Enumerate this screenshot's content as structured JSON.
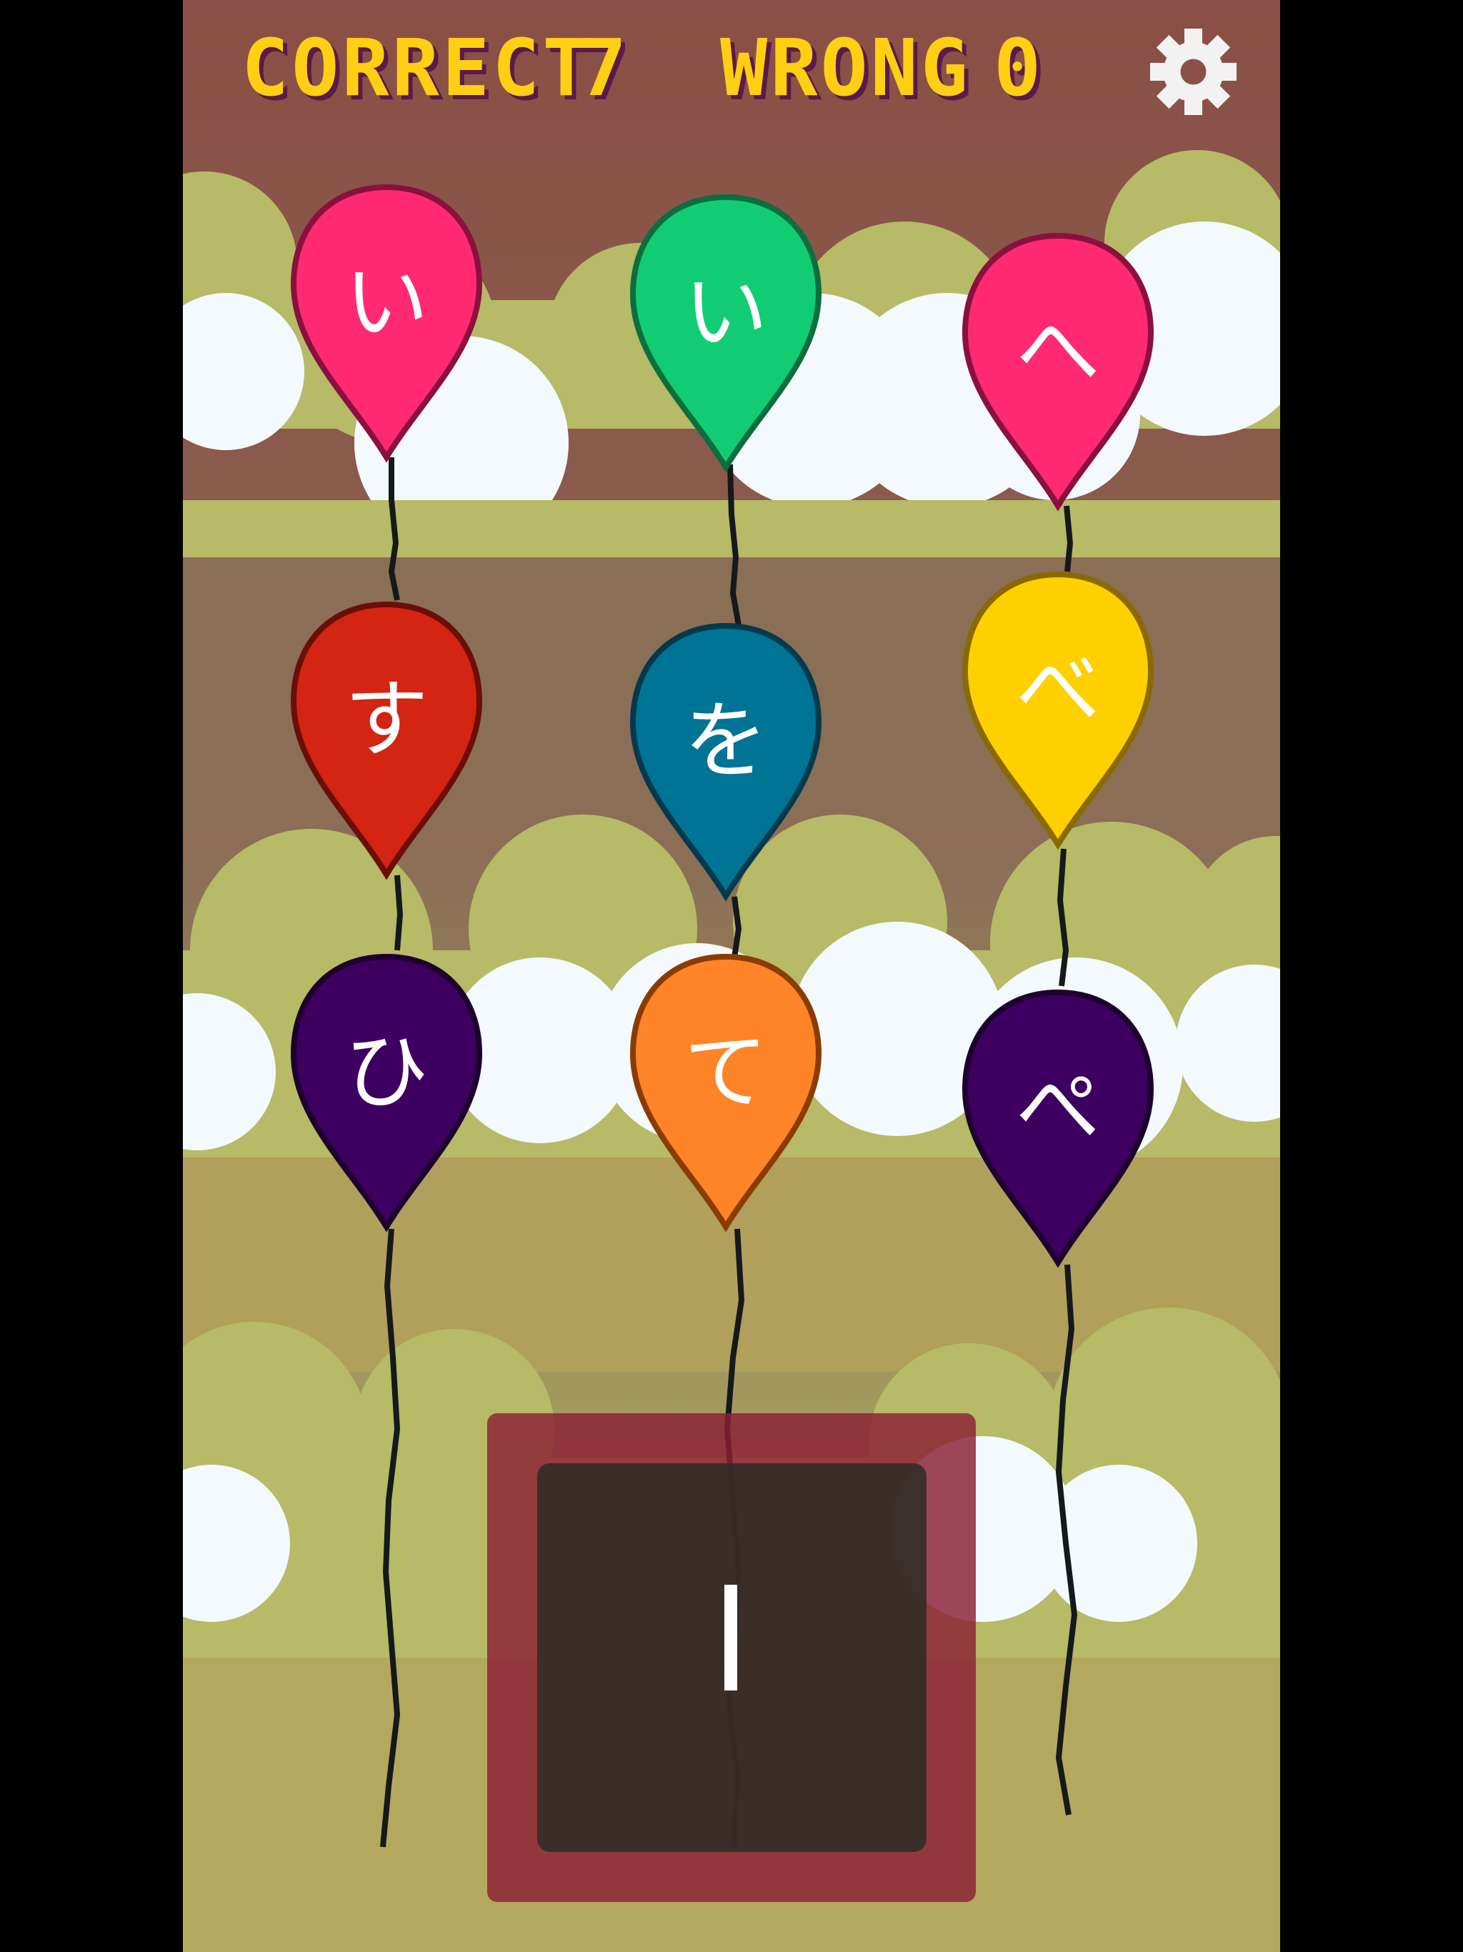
{
  "hud": {
    "correct_label": "CORRECT",
    "correct_value": "7",
    "wrong_label": "WRONG",
    "wrong_value": "0",
    "settings_icon": "gear-icon"
  },
  "balloons": [
    {
      "glyph": "い",
      "color": "#ff2a72",
      "outline": "#8a1040"
    },
    {
      "glyph": "い",
      "color": "#12cc74",
      "outline": "#0b6e3e"
    },
    {
      "glyph": "へ",
      "color": "#ff2a72",
      "outline": "#8a1040"
    },
    {
      "glyph": "す",
      "color": "#d42412",
      "outline": "#6a0f08"
    },
    {
      "glyph": "を",
      "color": "#007494",
      "outline": "#003a4c"
    },
    {
      "glyph": "べ",
      "color": "#ffd000",
      "outline": "#8a6a00"
    },
    {
      "glyph": "ひ",
      "color": "#3e0060",
      "outline": "#1e0030"
    },
    {
      "glyph": "て",
      "color": "#ff8428",
      "outline": "#8a3c00"
    },
    {
      "glyph": "ぺ",
      "color": "#3e0060",
      "outline": "#1e0030"
    }
  ],
  "answer": {
    "value": "",
    "frame_color": "#8b1e34",
    "inner_color": "#2c2c27"
  },
  "palette": {
    "sky_top": "#8a5146",
    "sky_mid": "#8a6c52",
    "ground": "#b2a95e",
    "cloud_olive": "#b7ba66",
    "cloud_white": "#f3f9fc",
    "hud_yellow": "#ffcf14"
  }
}
